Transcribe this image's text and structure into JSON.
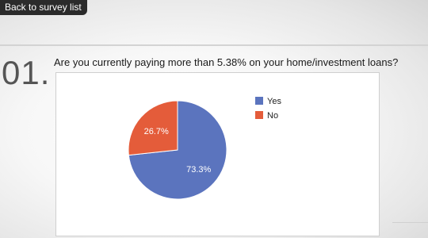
{
  "nav": {
    "back_label": "Back to survey list"
  },
  "question": {
    "number": "01.",
    "text": "Are you currently paying more than 5.38% on your home/investment loans?"
  },
  "chart_data": {
    "type": "pie",
    "categories": [
      "Yes",
      "No"
    ],
    "values": [
      73.3,
      26.7
    ],
    "labels": [
      "73.3%",
      "26.7%"
    ],
    "colors": [
      "#5b74be",
      "#e45c3a"
    ],
    "legend_position": "right"
  }
}
